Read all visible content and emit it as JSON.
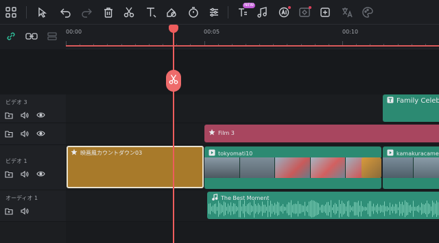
{
  "toolbar": {
    "new_badge": "NEW"
  },
  "ruler": {
    "labels": [
      "00:00",
      "00:05",
      "00:10"
    ]
  },
  "tracks": {
    "video3_label": "ビデオ 3",
    "video1_label": "ビデオ 1",
    "audio1_label": "オーディオ 1"
  },
  "clips": {
    "family": "Family Celeb",
    "film": "Film 3",
    "countdown": "映画風カウントダウン03",
    "tokyo": "tokyomati10",
    "kamakura": "kamakuracame",
    "music": "The Best Moment"
  },
  "colors": {
    "accent": "#ee5d5d",
    "video_clip": "#2c8a72",
    "film_clip": "#a8465f",
    "countdown_clip": "#a87a2a",
    "audio_clip": "#2f8f78"
  }
}
